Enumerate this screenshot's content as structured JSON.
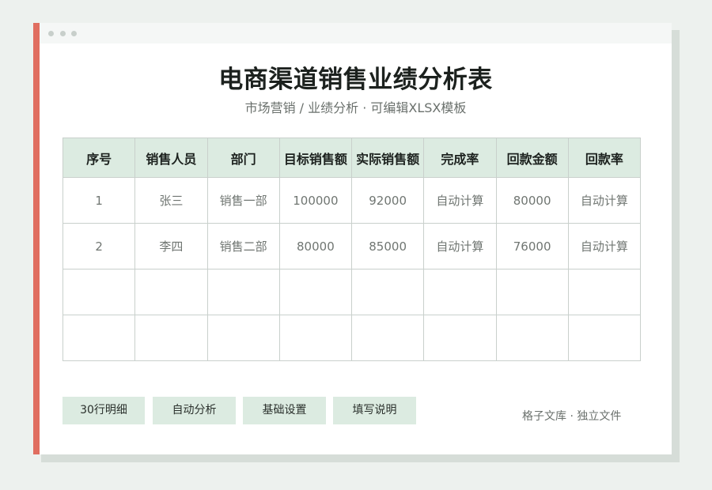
{
  "document": {
    "title": "电商渠道销售业绩分析表",
    "subtitle": "市场营销 / 业绩分析 · 可编辑XLSX模板"
  },
  "table": {
    "headers": [
      "序号",
      "销售人员",
      "部门",
      "目标销售额",
      "实际销售额",
      "完成率",
      "回款金额",
      "回款率"
    ],
    "rows": [
      [
        "1",
        "张三",
        "销售一部",
        "100000",
        "92000",
        "自动计算",
        "80000",
        "自动计算"
      ],
      [
        "2",
        "李四",
        "销售二部",
        "80000",
        "85000",
        "自动计算",
        "76000",
        "自动计算"
      ],
      [
        "",
        "",
        "",
        "",
        "",
        "",
        "",
        ""
      ],
      [
        "",
        "",
        "",
        "",
        "",
        "",
        "",
        ""
      ]
    ]
  },
  "buttons": [
    {
      "label": "30行明细"
    },
    {
      "label": "自动分析"
    },
    {
      "label": "基础设置"
    },
    {
      "label": "填写说明"
    }
  ],
  "footer": {
    "text": "格子文库 · 独立文件"
  },
  "colors": {
    "accent": "#e06e60",
    "header_bg": "#dcebe1",
    "page_bg": "#edf1ee"
  }
}
